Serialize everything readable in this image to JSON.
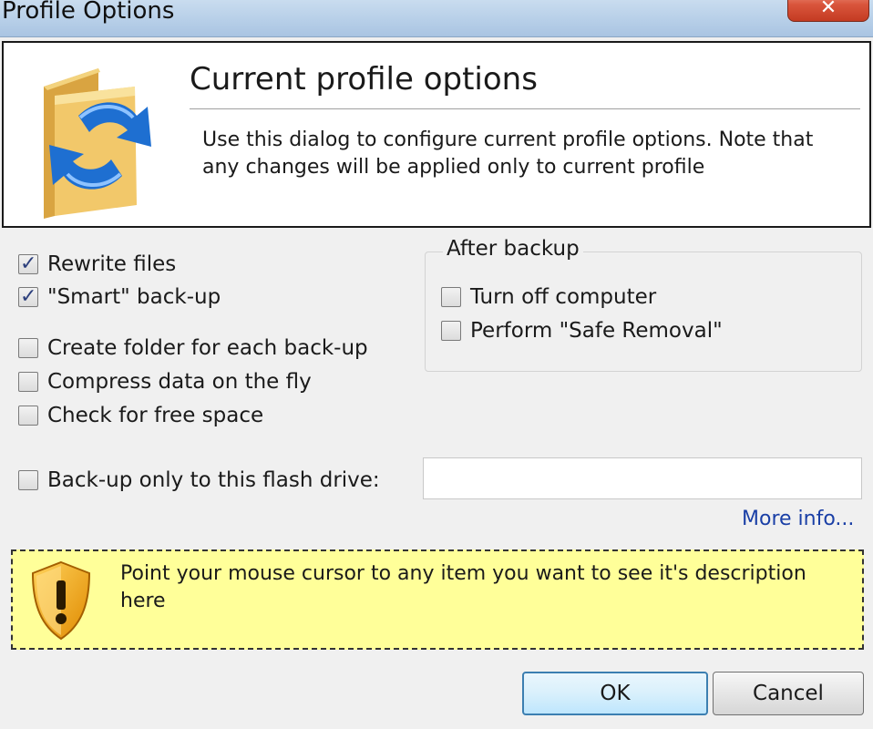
{
  "window": {
    "title": "Profile Options",
    "close_glyph": "✕"
  },
  "header": {
    "title": "Current profile options",
    "description": "Use this dialog to configure current profile options. Note that any changes will be applied only to current profile",
    "icon": "folder-sync-icon"
  },
  "options": [
    {
      "label": "Rewrite files",
      "checked": true
    },
    {
      "label": "\"Smart\" back-up",
      "checked": true
    },
    {
      "label": "Create folder for each back-up",
      "checked": false
    },
    {
      "label": "Compress data on the fly",
      "checked": false
    },
    {
      "label": "Check for free space",
      "checked": false
    }
  ],
  "after_backup": {
    "legend": "After backup",
    "options": [
      {
        "label": "Turn off computer",
        "checked": false
      },
      {
        "label": "Perform \"Safe Removal\"",
        "checked": false
      }
    ]
  },
  "flash_drive": {
    "label": "Back-up only to this flash drive:",
    "checked": false,
    "value": ""
  },
  "more_info": "More info...",
  "info": {
    "text": "Point your mouse cursor to any item you want to see it's description here",
    "icon": "warning-shield-icon"
  },
  "buttons": {
    "ok": "OK",
    "cancel": "Cancel"
  },
  "colors": {
    "info_background": "#ffff99",
    "link": "#1a3fa6",
    "check": "#2c3f7c"
  }
}
